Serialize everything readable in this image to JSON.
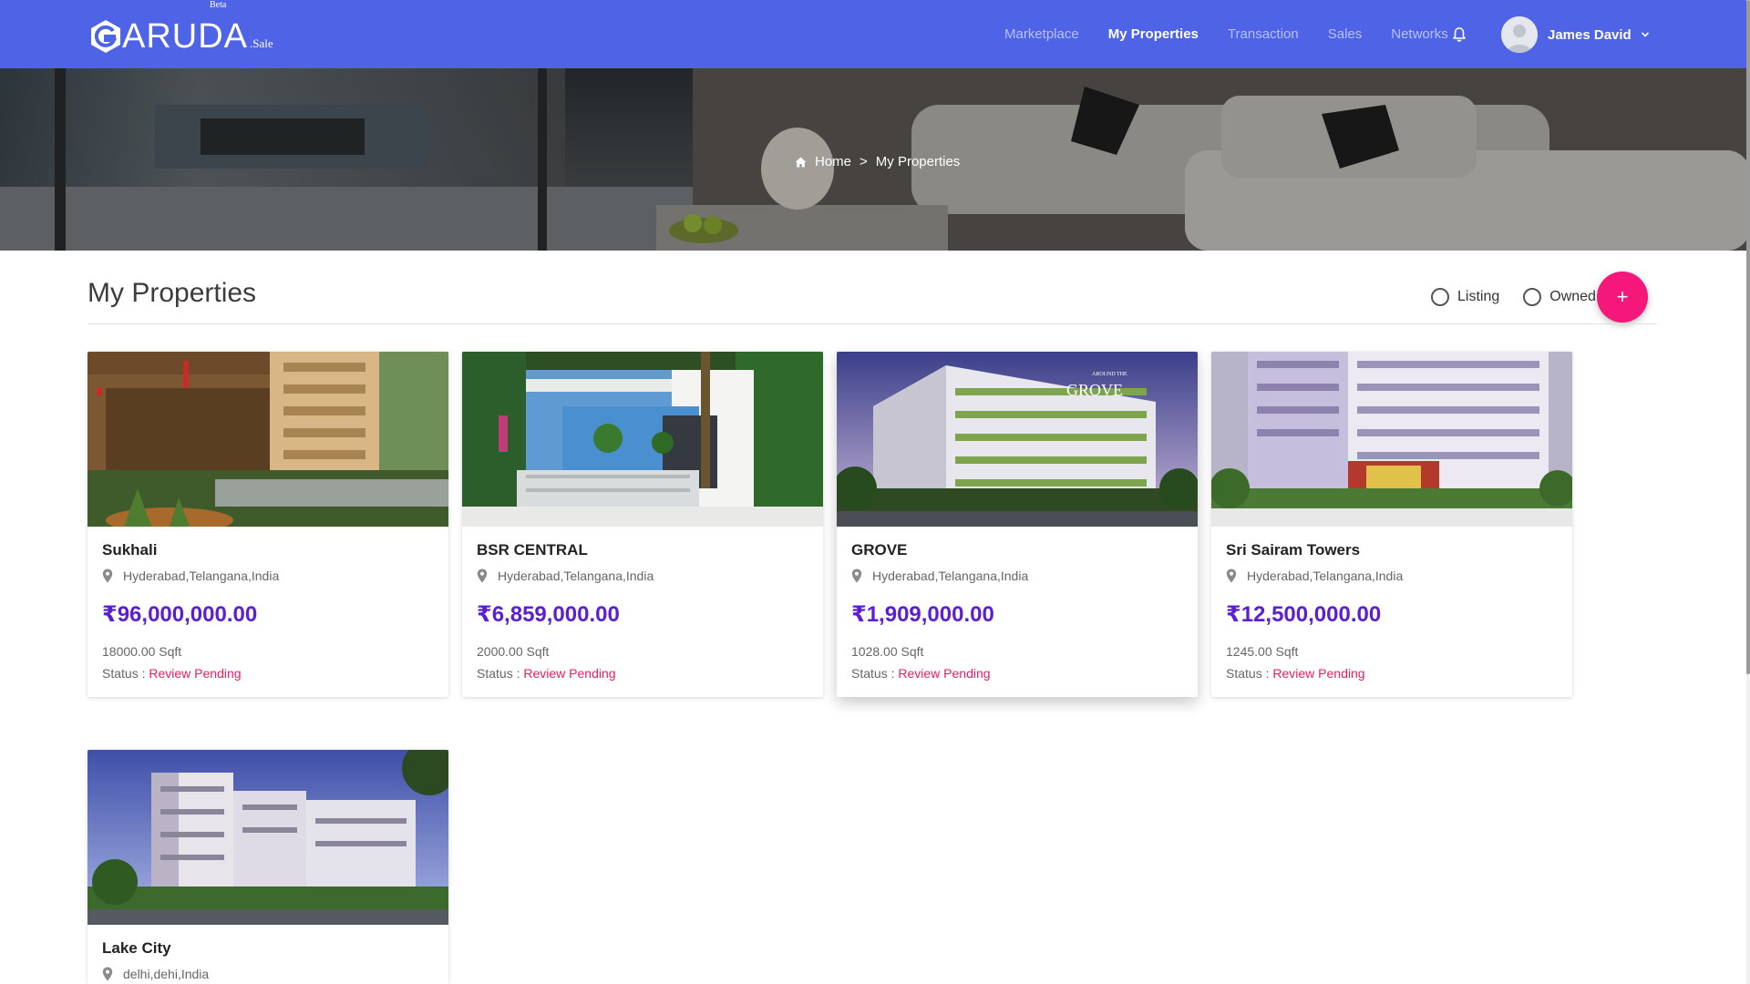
{
  "brand": {
    "logo_text": "ARUDA",
    "logo_beta": "Beta",
    "logo_sale": ".Sale",
    "primary_color": "#4e63e6",
    "accent_color": "#f5177a",
    "price_color": "#5b1fd1"
  },
  "nav": {
    "links": [
      {
        "label": "Marketplace",
        "active": false
      },
      {
        "label": "My Properties",
        "active": true
      },
      {
        "label": "Transaction",
        "active": false
      },
      {
        "label": "Sales",
        "active": false
      },
      {
        "label": "Networks",
        "active": false
      }
    ],
    "notification_icon": "bell-icon",
    "user_name": "James David"
  },
  "breadcrumb": {
    "home": "Home",
    "separator": ">",
    "current": "My Properties"
  },
  "page": {
    "title": "My Properties",
    "filters": [
      {
        "label": "Listing",
        "checked": false
      },
      {
        "label": "Owned",
        "checked": false
      }
    ],
    "add_button": "+"
  },
  "properties": [
    {
      "name": "Sukhali",
      "location": "Hyderabad,Telangana,India",
      "price": "₹96,000,000.00",
      "area": "18000.00 Sqft",
      "status_label": "Status :",
      "status": "Review Pending"
    },
    {
      "name": "BSR CENTRAL",
      "location": "Hyderabad,Telangana,India",
      "price": "₹6,859,000.00",
      "area": "2000.00 Sqft",
      "status_label": "Status :",
      "status": "Review Pending"
    },
    {
      "name": "GROVE",
      "location": "Hyderabad,Telangana,India",
      "price": "₹1,909,000.00",
      "area": "1028.00 Sqft",
      "status_label": "Status :",
      "status": "Review Pending",
      "image_text": "GROVE",
      "image_text_small": "AROUND THE"
    },
    {
      "name": "Sri Sairam Towers",
      "location": "Hyderabad,Telangana,India",
      "price": "₹12,500,000.00",
      "area": "1245.00 Sqft",
      "status_label": "Status :",
      "status": "Review Pending"
    },
    {
      "name": "Lake City",
      "location": "delhi,dehi,India",
      "price": "",
      "area": "",
      "status_label": "",
      "status": ""
    }
  ]
}
